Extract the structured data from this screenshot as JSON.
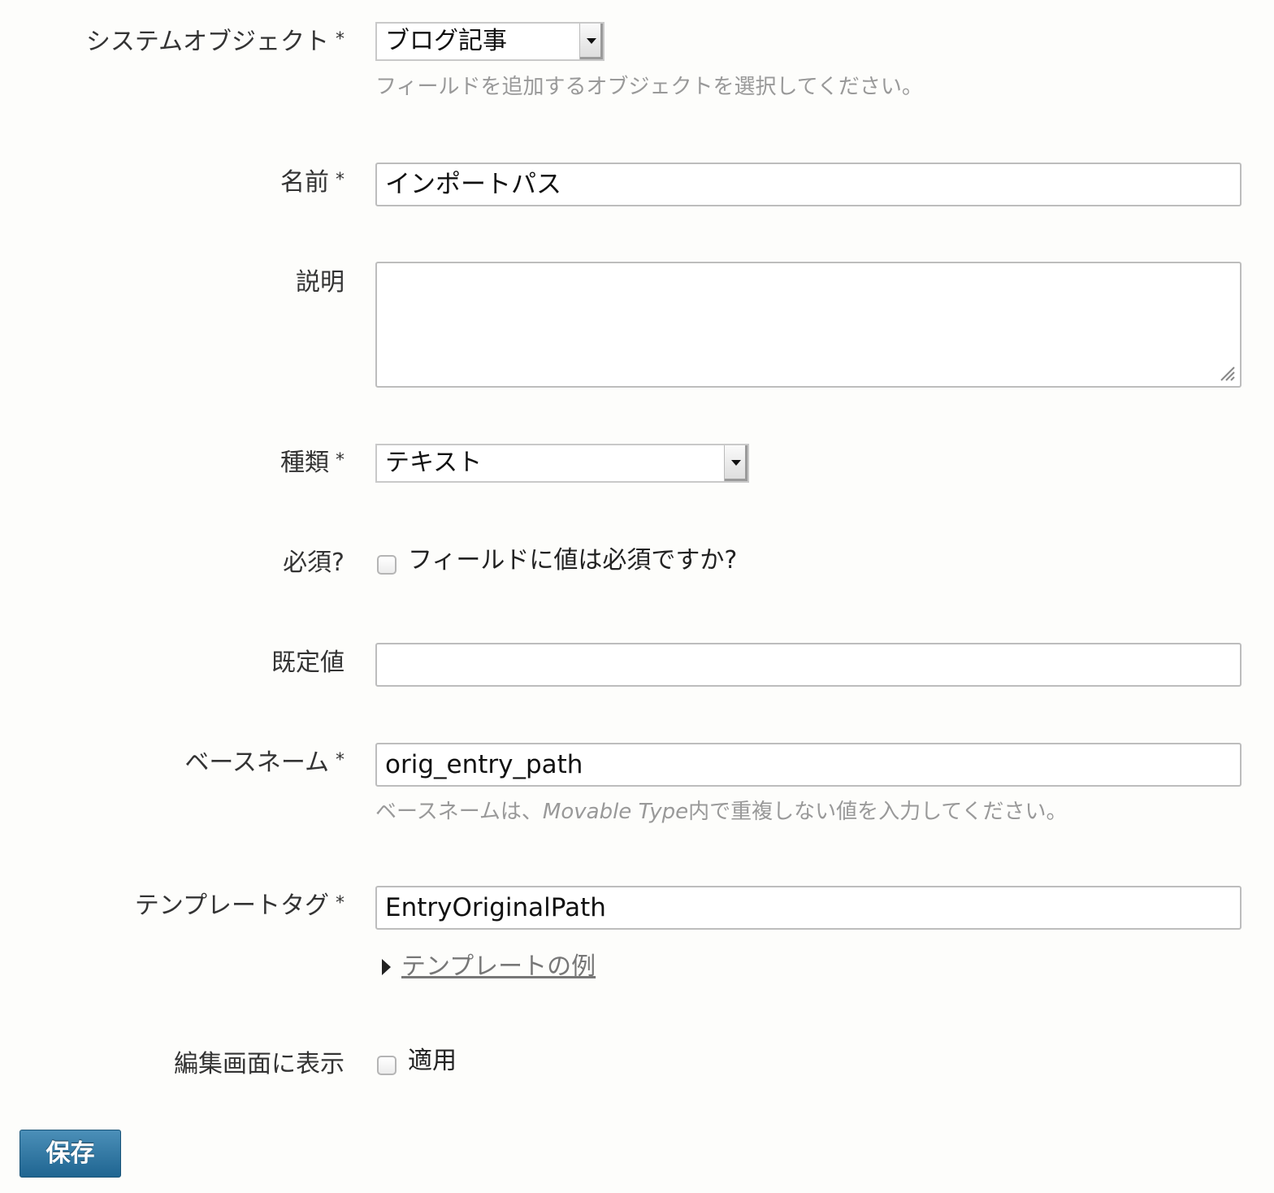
{
  "form": {
    "system_object": {
      "label": "システムオブジェクト",
      "required_mark": "*",
      "selected": "ブログ記事",
      "hint": "フィールドを追加するオブジェクトを選択してください。"
    },
    "name": {
      "label": "名前",
      "required_mark": "*",
      "value": "インポートパス"
    },
    "description": {
      "label": "説明",
      "value": ""
    },
    "type": {
      "label": "種類",
      "required_mark": "*",
      "selected": "テキスト"
    },
    "required": {
      "label": "必須?",
      "checkbox_label": "フィールドに値は必須ですか?",
      "checked": false
    },
    "default_value": {
      "label": "既定値",
      "value": ""
    },
    "basename": {
      "label": "ベースネーム",
      "required_mark": "*",
      "value": "orig_entry_path",
      "hint_prefix": "ベースネームは、",
      "hint_product": "Movable Type",
      "hint_suffix": "内で重複しない値を入力してください。"
    },
    "template_tag": {
      "label": "テンプレートタグ",
      "required_mark": "*",
      "value": "EntryOriginalPath",
      "example_link": "テンプレートの例"
    },
    "show_in_edit": {
      "label": "編集画面に表示",
      "checkbox_label": "適用",
      "checked": false
    },
    "save_label": "保存"
  }
}
